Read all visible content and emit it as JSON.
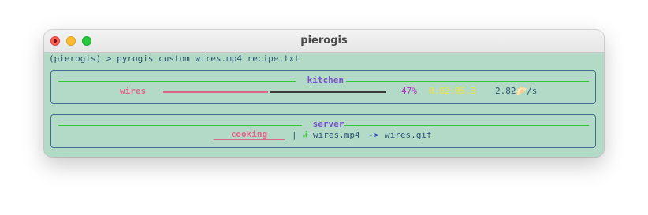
{
  "window": {
    "title": "pierogis"
  },
  "terminal": {
    "command": "(pierogis) > pyrogis custom wires.mp4 recipe.txt",
    "kitchen": {
      "title": "kitchen",
      "task": {
        "name": "wires",
        "progress": 0.47,
        "percent": "47%",
        "elapsed": "0:02:05.3",
        "rate": "2.82🥟/s"
      }
    },
    "server": {
      "title": "server",
      "status": "cooking",
      "separator": "|",
      "spinner": "⠼",
      "source": "wires.mp4",
      "arrow": "->",
      "output": "wires.gif"
    }
  },
  "colors": {
    "background": "#b3d9c7",
    "accent_pink": "#e0648a",
    "accent_purple": "#7a4fd1",
    "rule_green": "#35c435",
    "elapsed_yellow": "#f2e23a",
    "percent_magenta": "#b32cc4"
  },
  "icons": {
    "close": "close-light-icon",
    "minimize": "minimize-light-icon",
    "maximize": "maximize-light-icon",
    "rate_unit": "dumpling-icon"
  }
}
